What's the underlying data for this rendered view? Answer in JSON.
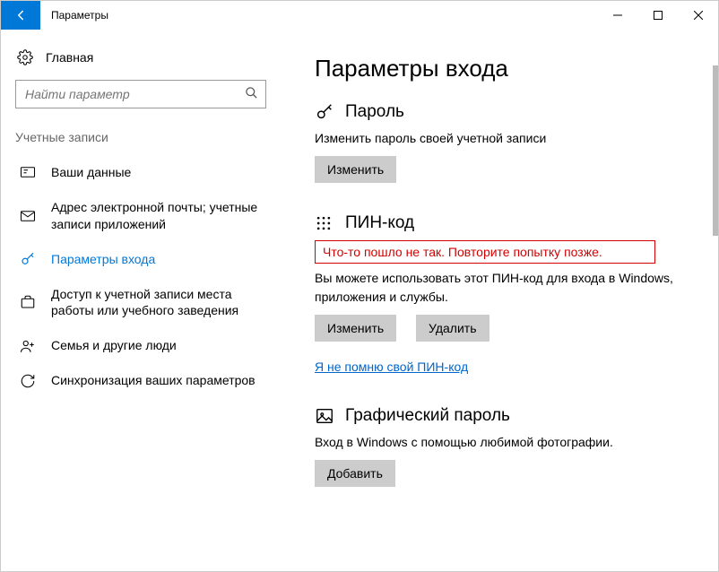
{
  "titlebar": {
    "title": "Параметры"
  },
  "sidebar": {
    "home_label": "Главная",
    "search_placeholder": "Найти параметр",
    "section_label": "Учетные записи",
    "items": [
      {
        "label": "Ваши данные"
      },
      {
        "label": "Адрес электронной почты; учетные записи приложений"
      },
      {
        "label": "Параметры входа"
      },
      {
        "label": "Доступ к учетной записи места работы или учебного заведения"
      },
      {
        "label": "Семья и другие люди"
      },
      {
        "label": "Синхронизация ваших параметров"
      }
    ]
  },
  "main": {
    "heading": "Параметры входа",
    "password": {
      "title": "Пароль",
      "desc": "Изменить пароль своей учетной записи",
      "change_btn": "Изменить"
    },
    "pin": {
      "title": "ПИН-код",
      "error": "Что-то пошло не так. Повторите попытку позже.",
      "desc": "Вы можете использовать этот ПИН-код для входа в Windows, приложения и службы.",
      "change_btn": "Изменить",
      "remove_btn": "Удалить",
      "forgot_link": "Я не помню свой ПИН-код"
    },
    "picture": {
      "title": "Графический пароль",
      "desc": "Вход в Windows с помощью любимой фотографии.",
      "add_btn": "Добавить"
    }
  }
}
